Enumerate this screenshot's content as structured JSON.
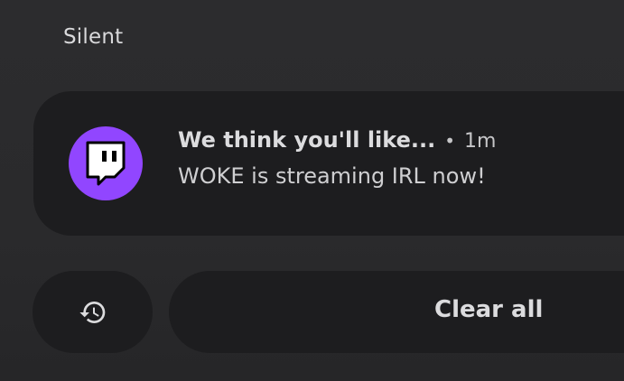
{
  "section": {
    "label": "Silent"
  },
  "notification": {
    "app_icon": "twitch-icon",
    "app_color": "#9146ff",
    "title": "We think you'll like...",
    "separator": "•",
    "time": "1m",
    "body": "WOKE is streaming IRL now!"
  },
  "actions": {
    "history_icon": "history-icon",
    "clear_all_label": "Clear all"
  }
}
